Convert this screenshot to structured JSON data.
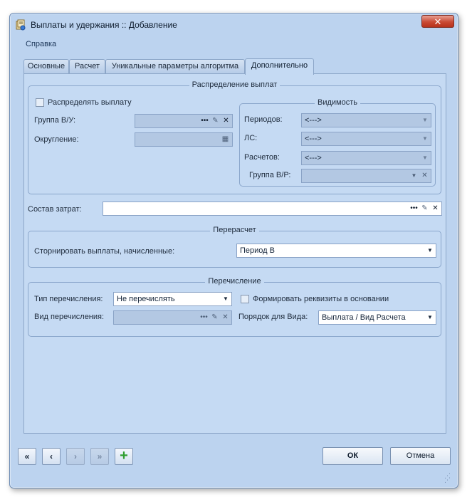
{
  "window": {
    "title": "Выплаты и удержания :: Добавление",
    "close_label": "✕"
  },
  "menu": {
    "help": "Справка"
  },
  "tabs": [
    {
      "label": "Основные",
      "active": false
    },
    {
      "label": "Расчет",
      "active": false
    },
    {
      "label": "Уникальные параметры алгоритма",
      "active": false
    },
    {
      "label": "Дополнительно",
      "active": true
    }
  ],
  "distribution": {
    "title": "Распределение выплат",
    "distribute_label": "Распределять выплату",
    "distribute_checked": false,
    "group_label": "Группа В/У:",
    "group_value": "",
    "rounding_label": "Округление:",
    "rounding_value": ""
  },
  "visibility": {
    "title": "Видимость",
    "periods_label": "Периодов:",
    "periods_value": "<--->",
    "ls_label": "ЛС:",
    "ls_value": "<--->",
    "calcs_label": "Расчетов:",
    "calcs_value": "<--->",
    "group_vr_label": "Группа В/Р:",
    "group_vr_value": ""
  },
  "cost": {
    "label": "Состав затрат:",
    "value": ""
  },
  "recalc": {
    "title": "Перерасчет",
    "storno_label": "Сторнировать выплаты, начисленные:",
    "storno_value": "Период В"
  },
  "transfer": {
    "title": "Перечисление",
    "type_label": "Тип перечисления:",
    "type_value": "Не перечислять",
    "form_requisites_label": "Формировать реквизиты в основании",
    "form_requisites_checked": false,
    "kind_label": "Вид перечисления:",
    "kind_value": "",
    "order_label": "Порядок для Вида:",
    "order_value": "Выплата / Вид Расчета"
  },
  "footer": {
    "first_label": "«",
    "prev_label": "‹",
    "next_label": "›",
    "last_label": "»",
    "add_label": "+",
    "ok_label": "ОК",
    "cancel_label": "Отмена"
  },
  "colors": {
    "window_bg": "#bcd3ef",
    "panel_bg": "#c5daf3",
    "close_red": "#c94a34",
    "add_green": "#2f9e2f"
  },
  "icons": {
    "app": "app-icon",
    "ellipsis": "ellipsis-icon",
    "pick": "pick-icon",
    "clear": "clear-icon",
    "calculator": "calculator-icon",
    "dropdown": "chevron-down-icon"
  }
}
